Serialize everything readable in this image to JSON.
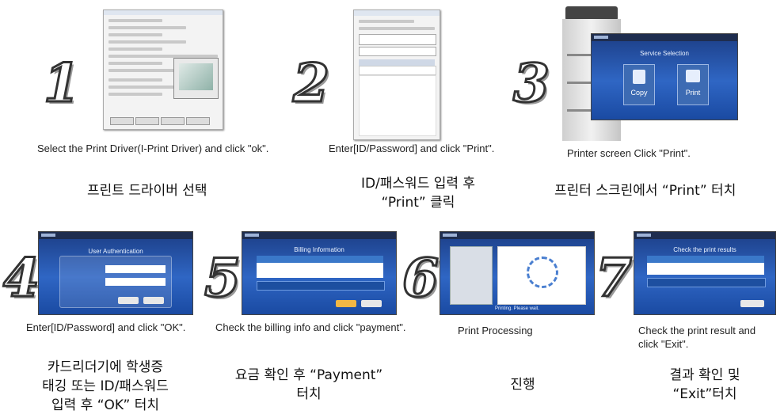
{
  "steps": [
    {
      "number": "1",
      "caption": "Select the Print Driver(I-Print Driver) and click \"ok\".",
      "korean": "프린트 드라이버 선택"
    },
    {
      "number": "2",
      "caption": "Enter[ID/Password] and click \"Print\".",
      "korean_line1": "ID/패스워드 입력 후",
      "korean_line2": "“Print” 클릭"
    },
    {
      "number": "3",
      "caption": "Printer screen Click \"Print\".",
      "korean": "프린터 스크린에서 “Print” 터치",
      "screen": {
        "title": "Service Selection",
        "copy": "Copy",
        "print": "Print"
      }
    },
    {
      "number": "4",
      "caption": "Enter[ID/Password] and click \"OK\".",
      "korean_line1": "카드리더기에 학생증",
      "korean_line2": "태깅 또는 ID/패스워드",
      "korean_line3": "입력 후 “OK” 터치",
      "screen": {
        "title": "User Authentication"
      }
    },
    {
      "number": "5",
      "caption": "Check the billing info and click \"payment\".",
      "korean_line1": "요금 확인 후 “Payment”",
      "korean_line2": "터치",
      "screen": {
        "title": "Billing Information"
      }
    },
    {
      "number": "6",
      "caption": "Print Processing",
      "korean": "진행",
      "screen": {
        "status": "Printing. Please wait."
      }
    },
    {
      "number": "7",
      "caption_line1": "Check the print result and",
      "caption_line2": "click \"Exit\".",
      "korean_line1": "결과 확인 및",
      "korean_line2": "“Exit”터치",
      "screen": {
        "title": "Check the print results"
      }
    }
  ],
  "colors": {
    "kiosk_blue": "#2f66c4",
    "bar_dark": "#1e2d4f"
  }
}
